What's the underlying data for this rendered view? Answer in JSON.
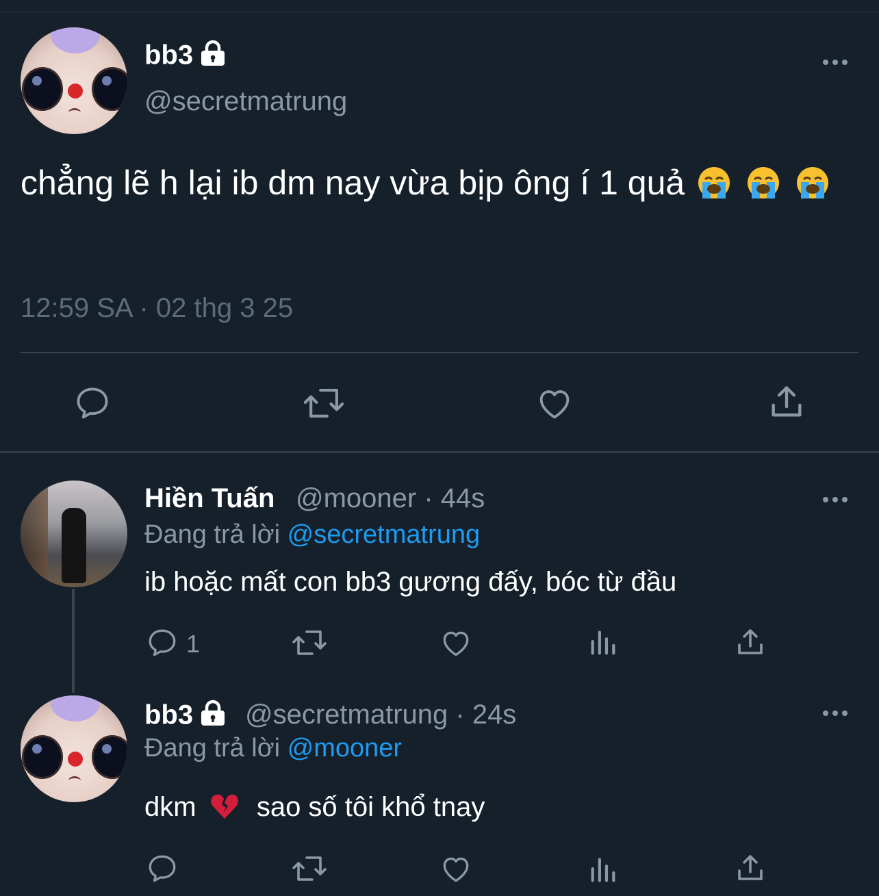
{
  "main_tweet": {
    "name": "bb3",
    "handle": "@secretmatrung",
    "text": "chẳng lẽ h lại ib dm nay vừa bịp ông í 1 quả",
    "timestamp": "12:59 SA · 02 thg 3 25"
  },
  "replies": [
    {
      "name": "Hiền Tuấn",
      "handle_time": "@mooner · 44s",
      "replying_prefix": "Đang trả lời ",
      "replying_to": "@secretmatrung",
      "text": "ib hoặc mất con bb3 gương đấy, bóc từ đầu",
      "reply_count": "1"
    },
    {
      "name": "bb3",
      "handle_time": "@secretmatrung · 24s",
      "replying_prefix": "Đang trả lời ",
      "replying_to": "@mooner",
      "text_part1": "dkm",
      "text_part2": "sao số tôi khổ tnay"
    }
  ],
  "icons": [
    "lock-icon",
    "more-icon",
    "reply-icon",
    "retweet-icon",
    "like-icon",
    "share-icon",
    "analytics-icon",
    "crying-emoji",
    "broken-heart-emoji"
  ],
  "colors": {
    "background": "#15202b",
    "accent": "#1d9bf0",
    "secondary_text": "#8b98a5",
    "divider": "#38444d"
  }
}
